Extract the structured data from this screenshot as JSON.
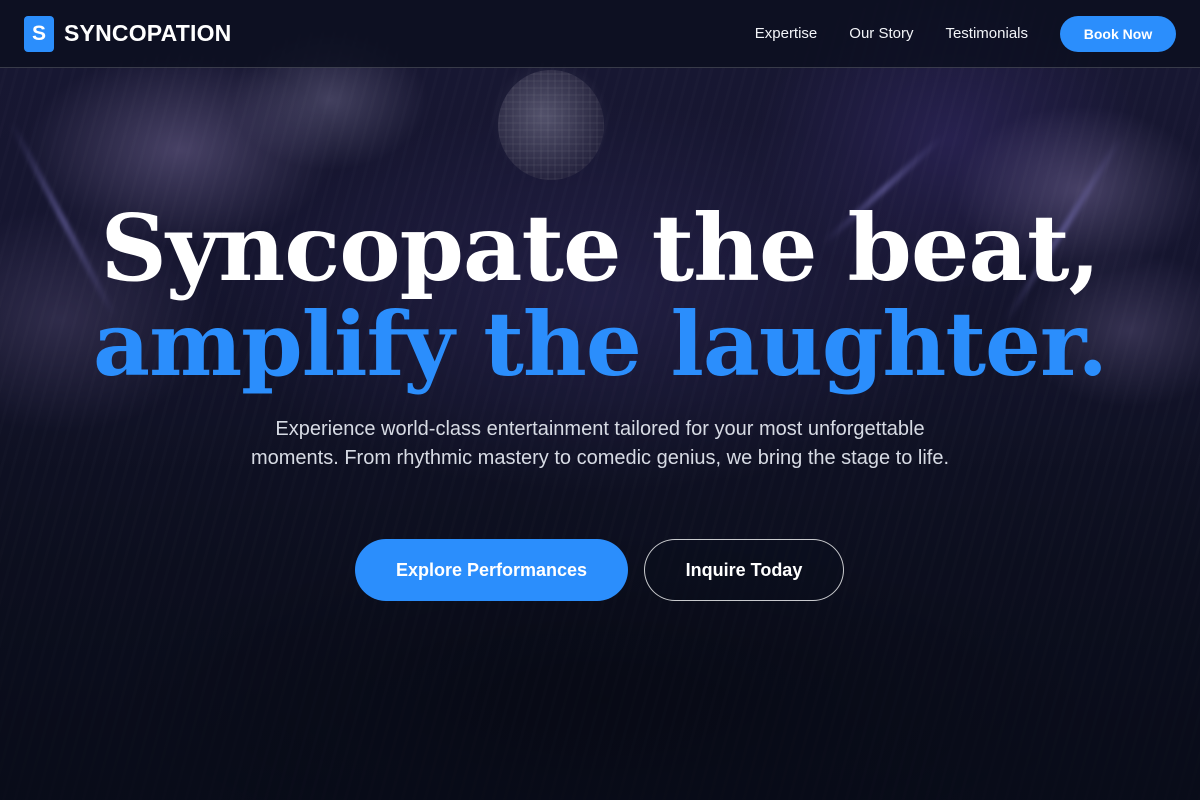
{
  "brand": {
    "mark": "S",
    "name": "SYNCOPATION"
  },
  "nav": {
    "links": [
      "Expertise",
      "Our Story",
      "Testimonials"
    ],
    "cta_label": "Book Now"
  },
  "hero": {
    "headline_line1": "Syncopate the beat,",
    "headline_line2": "amplify the laughter.",
    "subtitle": "Experience world-class entertainment tailored for your most unforgettable moments. From rhythmic mastery to comedic genius, we bring the stage to life.",
    "primary_button": "Explore Performances",
    "secondary_button": "Inquire Today"
  },
  "colors": {
    "accent": "#2b8efc",
    "background": "#0b0f1e",
    "text": "#ffffff",
    "muted_text": "#d7dbe4"
  }
}
